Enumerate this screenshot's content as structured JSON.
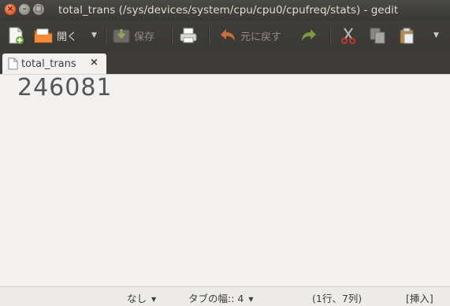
{
  "window": {
    "title": "total_trans (/sys/devices/system/cpu/cpu0/cpufreq/stats) - gedit"
  },
  "toolbar": {
    "new_icon": "new-document-icon",
    "open_label": "開く",
    "save_label": "保存",
    "undo_label": "元に戻す",
    "icons": [
      "new-document-icon",
      "open-folder-icon",
      "save-icon",
      "print-icon",
      "undo-icon",
      "redo-icon",
      "cut-icon",
      "copy-icon",
      "paste-icon"
    ]
  },
  "tab": {
    "label": "total_trans",
    "close_glyph": "×"
  },
  "editor": {
    "text": "246081"
  },
  "statusbar": {
    "highlight_mode": "なし",
    "tab_width": "タブの幅:: 4",
    "cursor_position": "(1行、7列)",
    "insert_mode": "[挿入]"
  },
  "colors": {
    "close_button": "#e2541f",
    "window_chrome": "#3c3b37",
    "editor_bg": "#f2f1ef"
  }
}
